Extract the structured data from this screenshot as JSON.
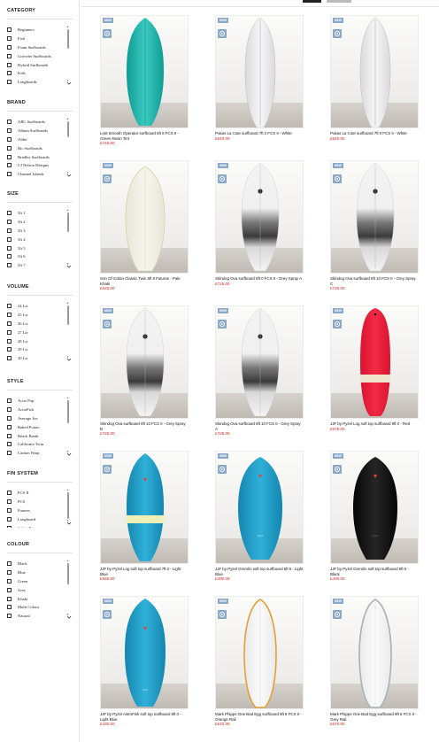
{
  "sidebar": {
    "facets": [
      {
        "title": "CATEGORY",
        "items": [
          "Beginners",
          "Fish",
          "Foam Surfboards",
          "Groveler Surfboards",
          "Hybrid Surfboards",
          "Kids",
          "Longboards",
          "Mid Length"
        ]
      },
      {
        "title": "BRAND",
        "items": [
          "ABC Surfboards",
          "Album Surfboards",
          "Alder",
          "Bic Surfboards",
          "Bradley Surfboards",
          "CJ Nelson Designs",
          "Channel Islands",
          "Degrain"
        ]
      },
      {
        "title": "SIZE",
        "items": [
          "5ft 1",
          "5ft 2",
          "5ft 3",
          "5ft 4",
          "5ft 5",
          "5ft 6",
          "5ft 7",
          "5ft 8"
        ]
      },
      {
        "title": "VOLUME",
        "items": [
          "24 Ltr",
          "25 Ltr",
          "26 Ltr",
          "27 Ltr",
          "28 Ltr",
          "29 Ltr",
          "30 Ltr",
          "31 Ltr"
        ]
      },
      {
        "title": "STYLE",
        "items": [
          "Acoo Pop",
          "AcooFish",
          "Average Joe",
          "Baked Potato",
          "Beach Break",
          "California Twin",
          "Carbon Wrap",
          "Classic Twin"
        ]
      },
      {
        "title": "FIN SYSTEM",
        "items": [
          "FCS II",
          "FCS",
          "Futures",
          "Longboard",
          "Safety Fins"
        ]
      },
      {
        "title": "COLOUR",
        "items": [
          "Black",
          "Blue",
          "Green",
          "Grey",
          "Khaki",
          "Multi Colour",
          "Natural",
          "Navy"
        ]
      }
    ]
  },
  "products": [
    {
      "badge": "NEW",
      "title": "Lost Smooth Operator surfboard 6ft 8 FCS II - Green Resin Tint",
      "price": "£745.00",
      "board": "green-fish"
    },
    {
      "badge": "NEW",
      "title": "Pukas La Cote surfboard 7ft 2 FCS II - White",
      "price": "£640.00",
      "board": "white-single"
    },
    {
      "badge": "NEW",
      "title": "Pukas La Cote surfboard 7ft 0 FCS II - White",
      "price": "£640.00",
      "board": "white-single"
    },
    {
      "badge": "NEW",
      "title": "Son Of Cobra Classic Twin 5ft 8 Futures - Pale Khaki",
      "price": "£625.00",
      "board": "khaki-twin"
    },
    {
      "badge": "NEW",
      "title": "Skindog Ova surfboard 6ft 0 FCS II - Grey Spray A",
      "price": "£725.00",
      "board": "grey-spray"
    },
    {
      "badge": "NEW",
      "title": "Skindog Ova surfboard 6ft 10 FCS II - Grey Spray C",
      "price": "£725.00",
      "board": "grey-spray"
    },
    {
      "badge": "NEW",
      "title": "Skindog Ova surfboard 6ft 10 FCS II - Grey Spray B",
      "price": "£725.00",
      "board": "grey-spray"
    },
    {
      "badge": "NEW",
      "title": "Skindog Ova surfboard 6ft 10 FCS II - Grey Spray A",
      "price": "£725.00",
      "board": "grey-spray"
    },
    {
      "badge": "NEW",
      "title": "JJF by Pyzel Log soft top surfboard 9ft 0 - Red",
      "price": "£675.00",
      "board": "red-log"
    },
    {
      "badge": "NEW",
      "title": "JJF by Pyzel Log soft top surfboard 7ft 0 - Light Blue",
      "price": "£565.00",
      "board": "blue-stripe"
    },
    {
      "badge": "NEW",
      "title": "JJF by Pyzel Gremlin soft top surfboard 5ft 6 - Light Blue",
      "price": "£490.00",
      "board": "blue-gremlin"
    },
    {
      "badge": "NEW",
      "title": "JJF by Pyzel Gremlin soft top surfboard 5ft 6 - Black",
      "price": "£490.00",
      "board": "black-gremlin"
    },
    {
      "badge": "NEW",
      "title": "JJF by Pyzel AstroFish soft top surfboard 6ft 0 - Light Blue",
      "price": "£430.00",
      "board": "blue-fish"
    },
    {
      "badge": "NEW",
      "title": "Mark Phipps One Bad Egg surfboard 6ft 6 FCS II - Orange Rail",
      "price": "£670.00",
      "board": "orange-egg"
    },
    {
      "badge": "NEW",
      "title": "Mark Phipps One Bad Egg surfboard 6ft 6 FCS II - Grey Rail",
      "price": "£670.00",
      "board": "grey-egg"
    }
  ]
}
